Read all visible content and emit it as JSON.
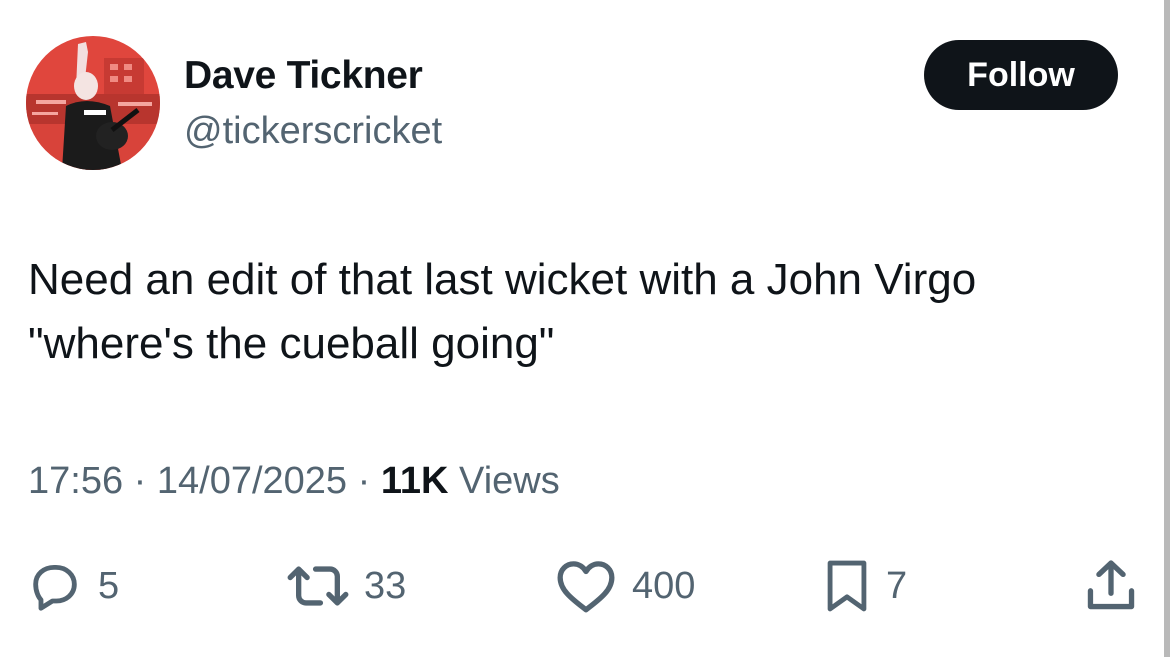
{
  "author": {
    "display_name": "Dave Tickner",
    "handle": "@tickerscricket"
  },
  "follow_label": "Follow",
  "tweet": {
    "lines": [
      "Need an edit of that last wicket with a John Virgo",
      "\"where's the cueball going\""
    ]
  },
  "meta": {
    "time": "17:56",
    "separator": "·",
    "date": "14/07/2025",
    "views_count": "11K",
    "views_label": "Views"
  },
  "actions": {
    "replies": "5",
    "reposts": "33",
    "likes": "400",
    "bookmarks": "7"
  },
  "icons": {
    "reply": "reply-icon",
    "repost": "repost-icon",
    "like": "heart-icon",
    "bookmark": "bookmark-icon",
    "share": "share-icon"
  },
  "colors": {
    "text_primary": "#0f1419",
    "text_secondary": "#536471",
    "follow_bg": "#0f1419",
    "avatar_bg": "#e0463d"
  }
}
